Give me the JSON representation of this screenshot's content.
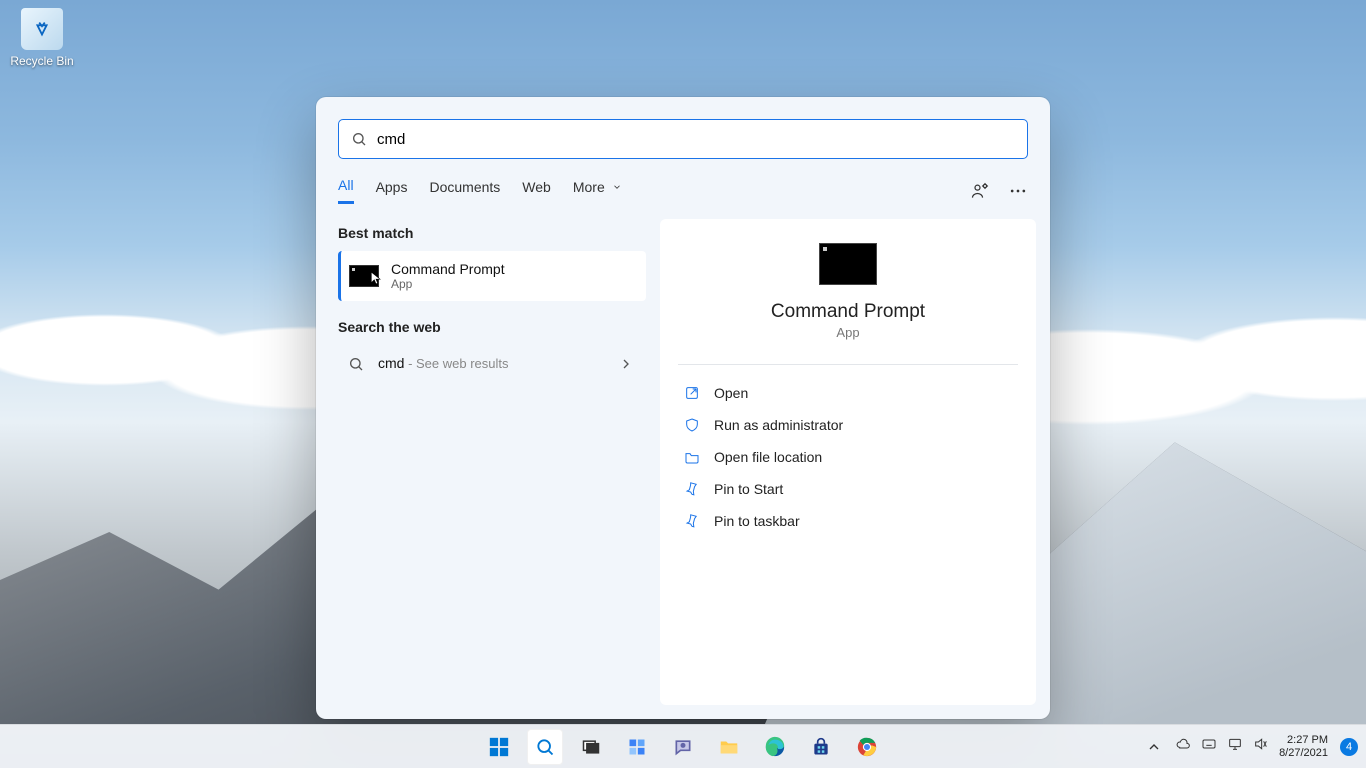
{
  "desktop": {
    "recycle_bin_label": "Recycle Bin"
  },
  "search": {
    "query": "cmd",
    "tabs": {
      "all": "All",
      "apps": "Apps",
      "documents": "Documents",
      "web": "Web",
      "more": "More"
    },
    "sections": {
      "best_match": "Best match",
      "search_web": "Search the web"
    },
    "best_match_result": {
      "name": "Command Prompt",
      "type": "App"
    },
    "web_result": {
      "term": "cmd",
      "hint": " - See web results"
    },
    "preview": {
      "title": "Command Prompt",
      "type": "App",
      "actions": {
        "open": "Open",
        "run_admin": "Run as administrator",
        "open_location": "Open file location",
        "pin_start": "Pin to Start",
        "pin_taskbar": "Pin to taskbar"
      }
    }
  },
  "tray": {
    "time": "2:27 PM",
    "date": "8/27/2021",
    "notif_count": "4"
  }
}
